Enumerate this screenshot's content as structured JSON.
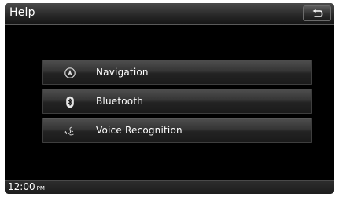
{
  "header": {
    "title": "Help",
    "back_icon": "back-arrow-icon"
  },
  "menu": {
    "items": [
      {
        "label": "Navigation",
        "icon": "navigation-compass-icon"
      },
      {
        "label": "Bluetooth",
        "icon": "bluetooth-icon"
      },
      {
        "label": "Voice Recognition",
        "icon": "voice-recognition-icon"
      }
    ]
  },
  "status": {
    "time": "12:00",
    "ampm": "PM"
  },
  "colors": {
    "screen_background": "#000000",
    "text": "#ffffff"
  }
}
